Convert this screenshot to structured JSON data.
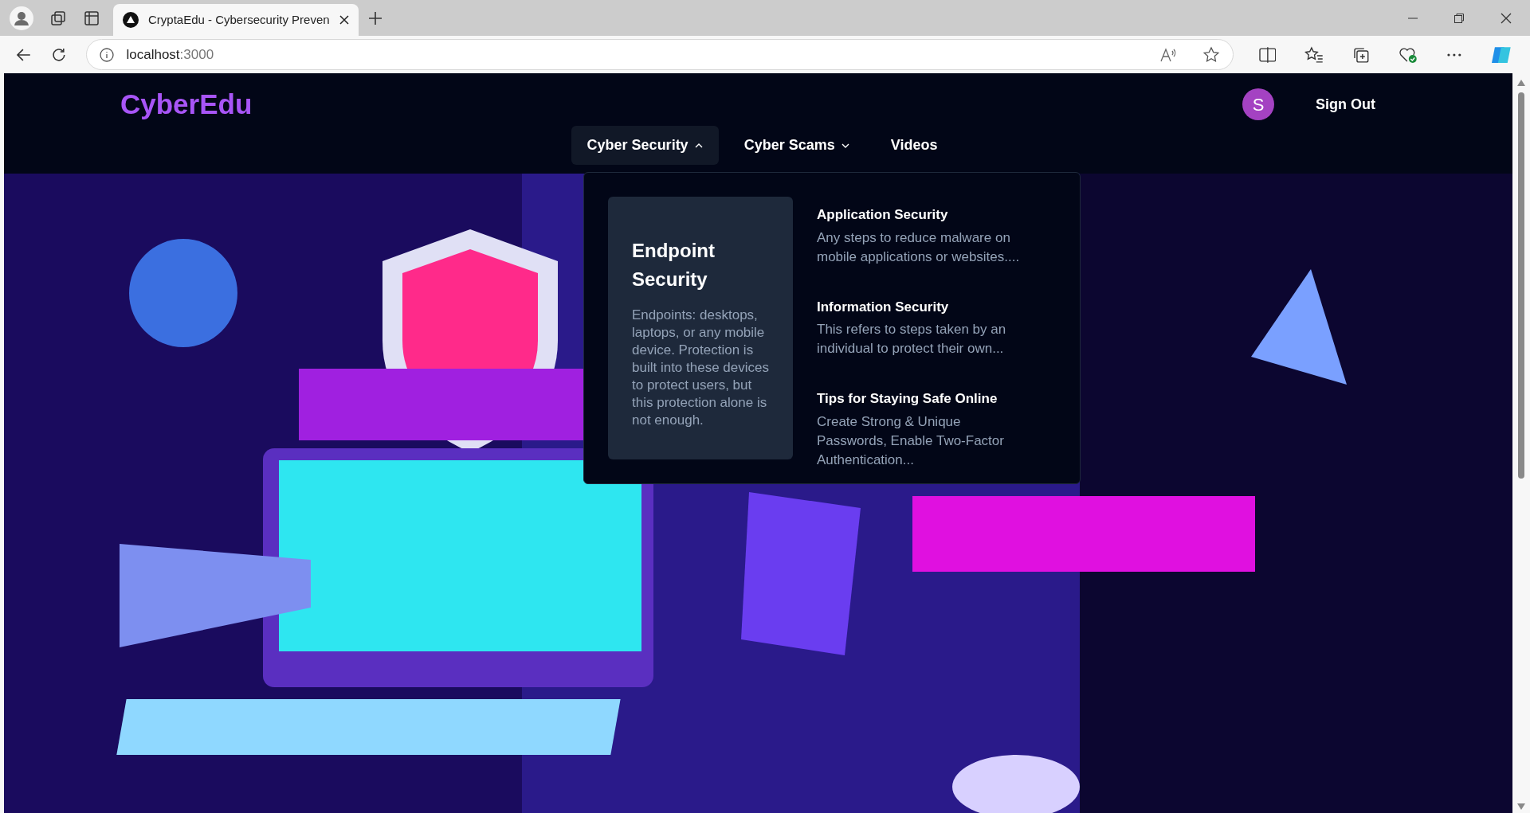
{
  "browser": {
    "tabs": [
      {
        "title": "CryptaEdu - Cybersecurity Preven",
        "selected": true
      }
    ],
    "address": {
      "host": "localhost",
      "port": ":3000"
    }
  },
  "header": {
    "logo": "CyberEdu",
    "avatar": "S",
    "sign_out": "Sign Out"
  },
  "nav": [
    {
      "label": "Cyber Security",
      "kind": "menu",
      "expanded": true
    },
    {
      "label": "Cyber Scams",
      "kind": "menu",
      "expanded": false
    },
    {
      "label": "Videos",
      "kind": "link",
      "expanded": false
    }
  ],
  "dropdown": {
    "featured": {
      "title": "Endpoint Security",
      "description": "Endpoints: desktops, laptops, or any mobile device. Protection is built into these devices to protect users, but this protection alone is not enough."
    },
    "items": [
      {
        "title": "Application Security",
        "description": "Any steps to reduce malware on mobile applications or websites...."
      },
      {
        "title": "Information Security",
        "description": "This refers to steps taken by an individual to protect their own..."
      },
      {
        "title": "Tips for Staying Safe Online",
        "description": "Create Strong & Unique Passwords, Enable Two-Factor Authentication..."
      }
    ]
  }
}
